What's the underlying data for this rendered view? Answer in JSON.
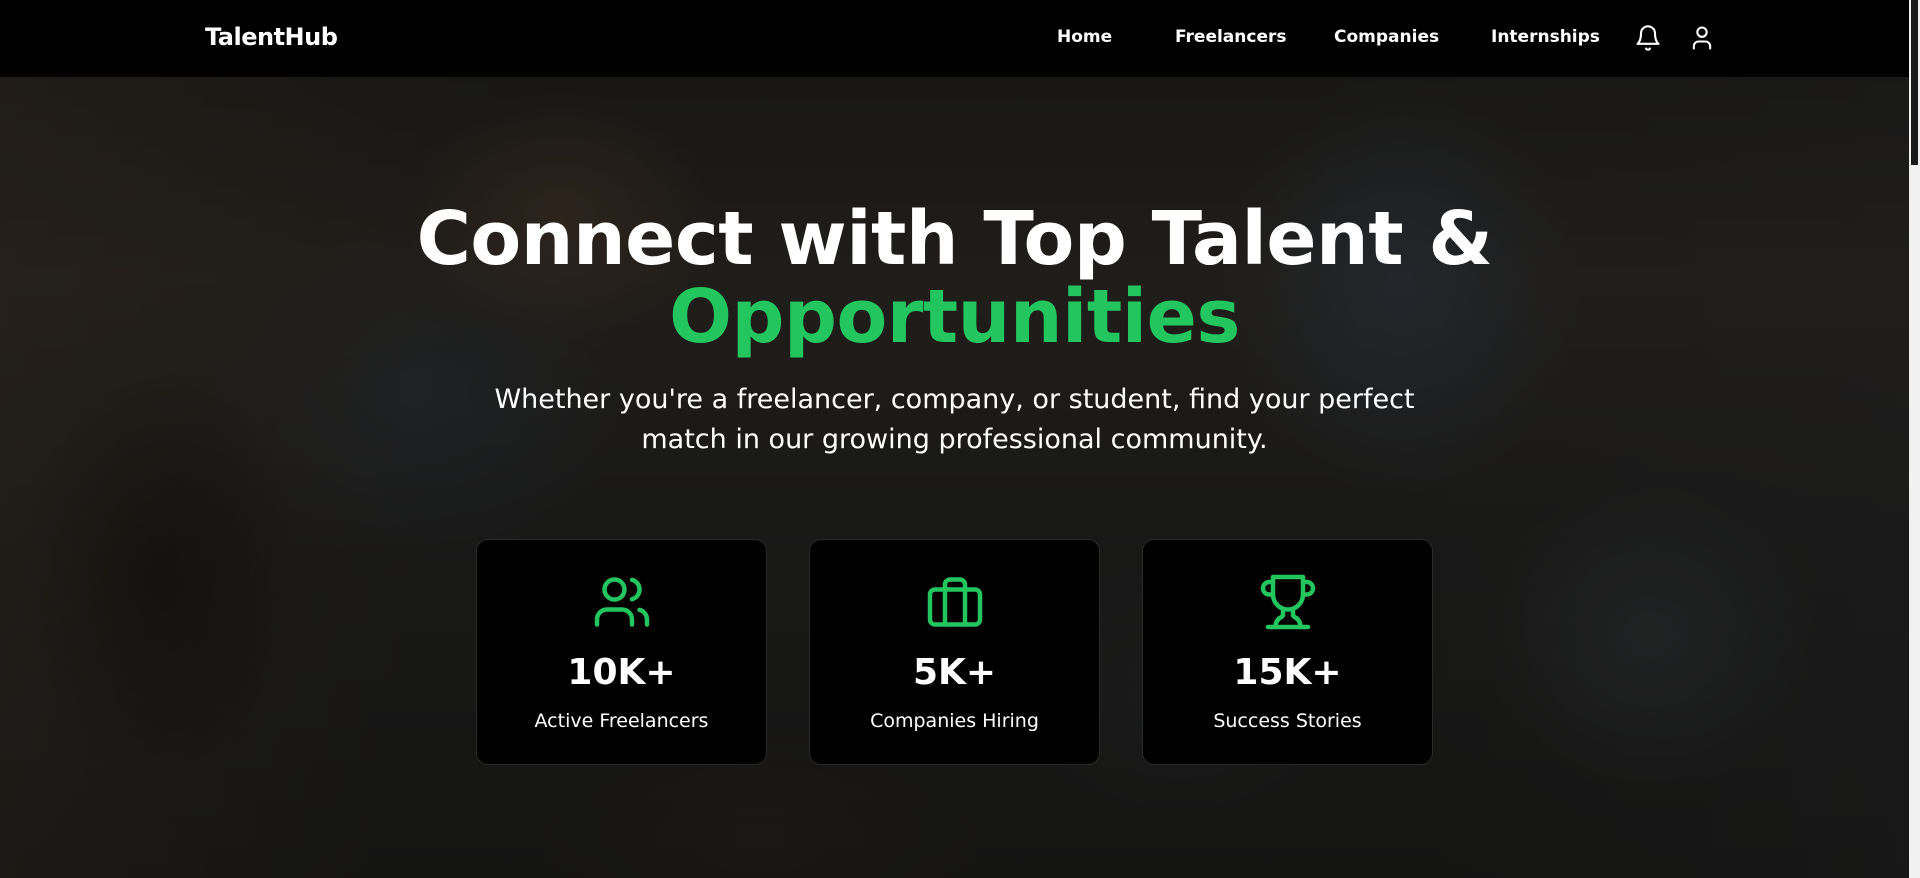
{
  "brand": {
    "name": "TalentHub"
  },
  "nav": {
    "items": [
      {
        "label": "Home"
      },
      {
        "label": "Freelancers"
      },
      {
        "label": "Companies"
      },
      {
        "label": "Internships"
      }
    ],
    "icons": [
      "bell-icon",
      "user-icon"
    ]
  },
  "hero": {
    "headline_line1": "Connect with Top Talent &",
    "headline_line2": "Opportunities",
    "subtitle_line1": "Whether you're a freelancer, company, or student, find your perfect",
    "subtitle_line2": "match in our growing professional community."
  },
  "stats": [
    {
      "value": "10K+",
      "label": "Active Freelancers",
      "icon": "users-icon"
    },
    {
      "value": "5K+",
      "label": "Companies Hiring",
      "icon": "briefcase-icon"
    },
    {
      "value": "15K+",
      "label": "Success Stories",
      "icon": "trophy-icon"
    }
  ],
  "colors": {
    "accent": "#22c55e",
    "navbar_bg": "#000000",
    "card_bg": "#000000",
    "text": "#ffffff"
  }
}
